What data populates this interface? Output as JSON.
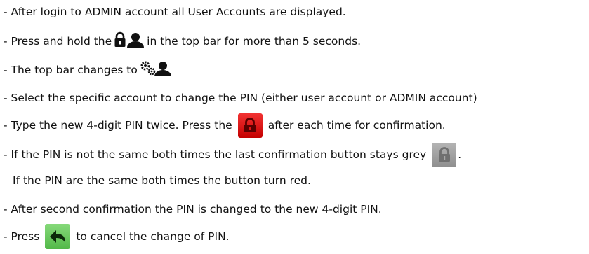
{
  "lines": [
    {
      "text": "- After login to ADMIN account all User Accounts are displayed."
    },
    {
      "before": "- Press and hold the",
      "after": "in the top bar for more than 5 seconds.",
      "icon": "lock-user-icon"
    },
    {
      "before": "- The top bar changes to",
      "icon": "gears-user-icon"
    },
    {
      "text": "- Select the specific account to change the PIN (either user account or ADMIN account)"
    },
    {
      "before": "- Type the new 4-digit PIN twice. Press the",
      "after": "after each time for confirmation.",
      "icon": "red-lock-button"
    },
    {
      "before": "- If the PIN is not the same both times the last confirmation button stays grey",
      "after": ".",
      "icon": "grey-lock-button"
    },
    {
      "text": "If the PIN are the same both times the button turn red."
    },
    {
      "text": "- After second confirmation the PIN is changed to the new 4-digit PIN."
    },
    {
      "before": "- Press",
      "after": "to cancel the change of PIN.",
      "icon": "green-back-button"
    }
  ],
  "colors": {
    "text": "#111111",
    "confirm_red": "#e01414",
    "inactive_grey": "#a0a0a0",
    "back_green": "#6ccb60"
  }
}
